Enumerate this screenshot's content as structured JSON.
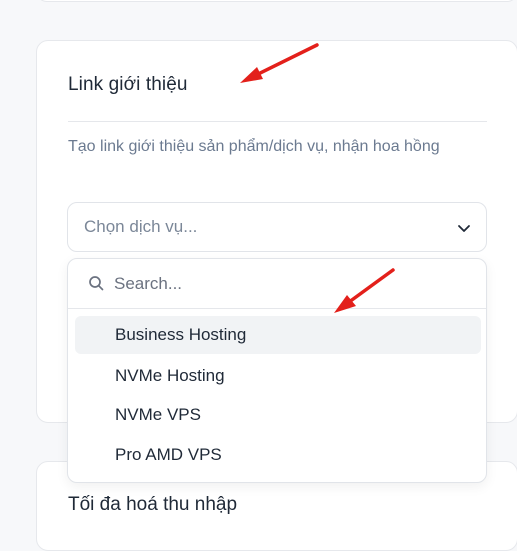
{
  "card": {
    "title": "Link giới thiệu",
    "description": "Tạo link giới thiệu sản phẩm/dịch vụ, nhận hoa hồng"
  },
  "select": {
    "placeholder": "Chọn dịch vụ..."
  },
  "dropdown": {
    "search_placeholder": "Search...",
    "options": [
      {
        "label": "Business Hosting",
        "highlighted": true
      },
      {
        "label": "NVMe Hosting",
        "highlighted": false
      },
      {
        "label": "NVMe VPS",
        "highlighted": false
      },
      {
        "label": "Pro AMD VPS",
        "highlighted": false
      }
    ]
  },
  "next_card": {
    "title": "Tối đa hoá thu nhập"
  },
  "colors": {
    "annotation_arrow": "#e3201b",
    "highlight_bg": "#f1f3f5",
    "muted_text": "#6b7a90"
  }
}
